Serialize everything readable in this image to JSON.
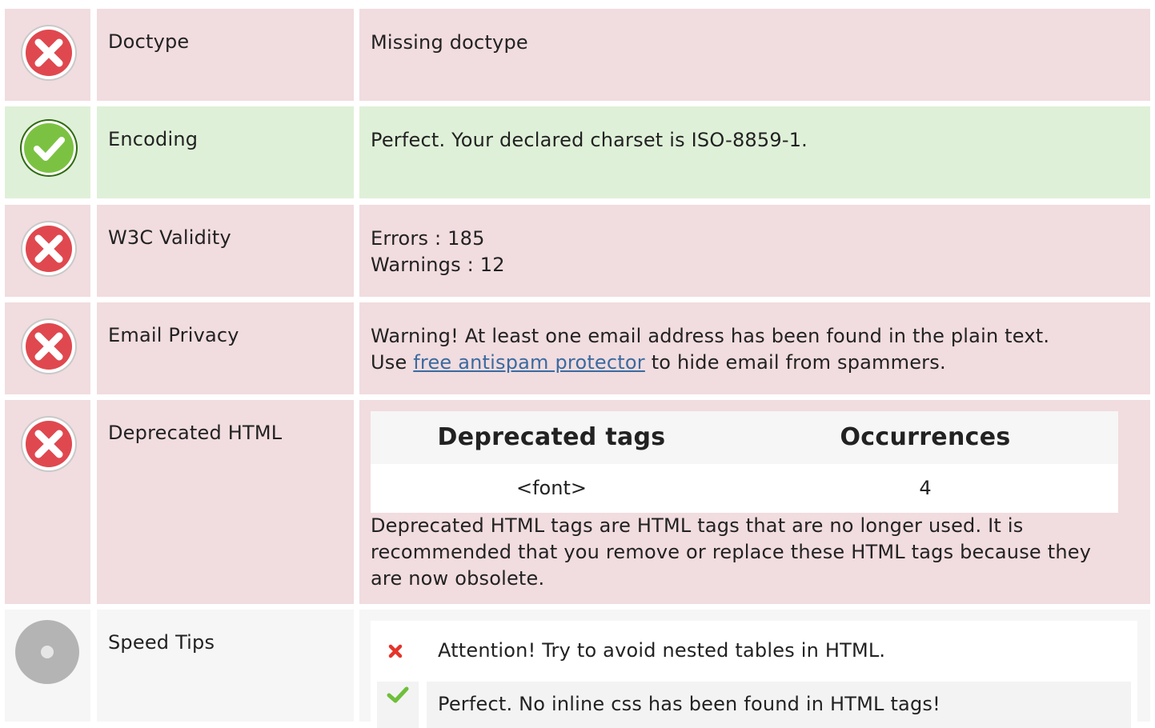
{
  "rows": {
    "doctype": {
      "label": "Doctype",
      "status": "error",
      "message": "Missing doctype"
    },
    "encoding": {
      "label": "Encoding",
      "status": "ok",
      "message": "Perfect. Your declared charset is ISO-8859-1."
    },
    "w3c": {
      "label": "W3C Validity",
      "status": "error",
      "errors": "Errors : 185",
      "warnings": "Warnings : 12"
    },
    "email": {
      "label": "Email Privacy",
      "status": "error",
      "line1": "Warning! At least one email address has been found in the plain text.",
      "line2_prefix": "Use ",
      "link_text": "free antispam protector",
      "line2_suffix": " to hide email from spammers."
    },
    "deprecated": {
      "label": "Deprecated HTML",
      "status": "error",
      "table": {
        "headers": [
          "Deprecated tags",
          "Occurrences"
        ],
        "rows": [
          {
            "tag": "<font>",
            "count": "4"
          }
        ]
      },
      "description": "Deprecated HTML tags are HTML tags that are no longer used. It is recommended that you remove or replace these HTML tags because they are now obsolete."
    },
    "speed": {
      "label": "Speed Tips",
      "status": "neutral",
      "tips": [
        {
          "status": "error",
          "text": "Attention! Try to avoid nested tables in HTML."
        },
        {
          "status": "ok",
          "text": "Perfect. No inline css has been found in HTML tags!"
        }
      ]
    }
  },
  "colors": {
    "error_bg": "#f1dcdf",
    "ok_bg": "#dff0d8",
    "neutral_bg": "#f6f6f6",
    "error_icon": "#e0484f",
    "ok_icon": "#7cc242",
    "link": "#3a6aa0"
  }
}
